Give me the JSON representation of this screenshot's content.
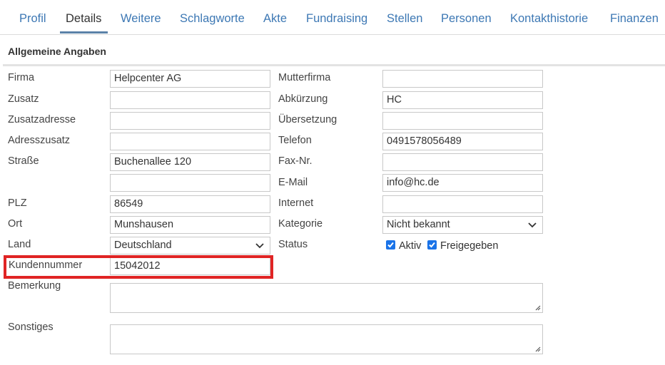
{
  "tabs": [
    {
      "label": "Profil",
      "active": false
    },
    {
      "label": "Details",
      "active": true
    },
    {
      "label": "Weitere",
      "active": false
    },
    {
      "label": "Schlagworte",
      "active": false
    },
    {
      "label": "Akte",
      "active": false
    },
    {
      "label": "Fundraising",
      "active": false
    },
    {
      "label": "Stellen",
      "active": false
    },
    {
      "label": "Personen",
      "active": false
    },
    {
      "label": "Kontakthistorie",
      "active": false
    },
    {
      "label": "Finanzen",
      "active": false
    }
  ],
  "section": {
    "title": "Allgemeine Angaben"
  },
  "left": {
    "firma": {
      "label": "Firma",
      "value": "Helpcenter AG"
    },
    "zusatz": {
      "label": "Zusatz",
      "value": ""
    },
    "zusatzadresse": {
      "label": "Zusatzadresse",
      "value": ""
    },
    "adresszusatz": {
      "label": "Adresszusatz",
      "value": ""
    },
    "strasse": {
      "label": "Straße",
      "value": "Buchenallee 120",
      "value2": ""
    },
    "plz": {
      "label": "PLZ",
      "value": "86549"
    },
    "ort": {
      "label": "Ort",
      "value": "Munshausen"
    },
    "land": {
      "label": "Land",
      "value": "Deutschland"
    },
    "kundennummer": {
      "label": "Kundennummer",
      "value": "15042012"
    },
    "bemerkung": {
      "label": "Bemerkung",
      "value": ""
    },
    "sonstiges": {
      "label": "Sonstiges",
      "value": ""
    }
  },
  "right": {
    "mutterfirma": {
      "label": "Mutterfirma",
      "value": ""
    },
    "abkuerzung": {
      "label": "Abkürzung",
      "value": "HC"
    },
    "uebersetzung": {
      "label": "Übersetzung",
      "value": ""
    },
    "telefon": {
      "label": "Telefon",
      "value": "0491578056489"
    },
    "fax": {
      "label": "Fax-Nr.",
      "value": ""
    },
    "email": {
      "label": "E-Mail",
      "value": "info@hc.de"
    },
    "internet": {
      "label": "Internet",
      "value": ""
    },
    "kategorie": {
      "label": "Kategorie",
      "value": "Nicht bekannt"
    },
    "status": {
      "label": "Status",
      "aktiv": {
        "label": "Aktiv",
        "checked": true
      },
      "freigegeben": {
        "label": "Freigegeben",
        "checked": true
      }
    }
  },
  "colors": {
    "link": "#3d78b4",
    "checkbox": "#1a73e8",
    "highlight": "#e02424"
  },
  "icons": {
    "select_arrow": "chevron-down-icon",
    "resize": "resize-grip-icon",
    "check": "check-icon"
  }
}
